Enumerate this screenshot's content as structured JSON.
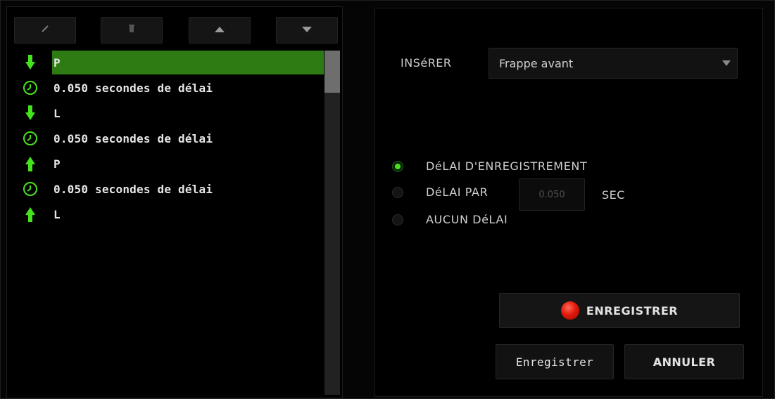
{
  "toolbar": {
    "buttons": [
      {
        "icon": "pencil-icon",
        "glyph": "╱"
      },
      {
        "icon": "trash-icon",
        "glyph": "▮"
      },
      {
        "icon": "arrow-up-icon",
        "glyph": "▲"
      },
      {
        "icon": "arrow-down-icon",
        "glyph": "▼"
      }
    ]
  },
  "macro_list": {
    "items": [
      {
        "type": "key-down",
        "icon": "arrow-down-icon",
        "label": "P",
        "selected": true
      },
      {
        "type": "delay",
        "icon": "clock-icon",
        "label": "0.050 secondes de délai",
        "selected": false
      },
      {
        "type": "key-down",
        "icon": "arrow-down-icon",
        "label": "L",
        "selected": false
      },
      {
        "type": "delay",
        "icon": "clock-icon",
        "label": "0.050 secondes de délai",
        "selected": false
      },
      {
        "type": "key-up",
        "icon": "arrow-up-icon",
        "label": "P",
        "selected": false
      },
      {
        "type": "delay",
        "icon": "clock-icon",
        "label": "0.050 secondes de délai",
        "selected": false
      },
      {
        "type": "key-up",
        "icon": "arrow-up-icon",
        "label": "L",
        "selected": false
      }
    ]
  },
  "insert": {
    "label": "INSéRER",
    "value": "Frappe avant"
  },
  "delay_options": {
    "record_label": "DéLAI D'ENREGISTREMENT",
    "fixed_label": "DéLAI PAR",
    "fixed_value": "0.050",
    "unit": "SEC",
    "none_label": "AUCUN DéLAI",
    "selected": "record"
  },
  "actions": {
    "record_label": "ENREGISTRER",
    "save_label": "Enregistrer",
    "cancel_label": "ANNULER"
  },
  "colors": {
    "accent": "#47e21e",
    "selected_row": "#2e7a13",
    "record": "#e01a0c"
  }
}
